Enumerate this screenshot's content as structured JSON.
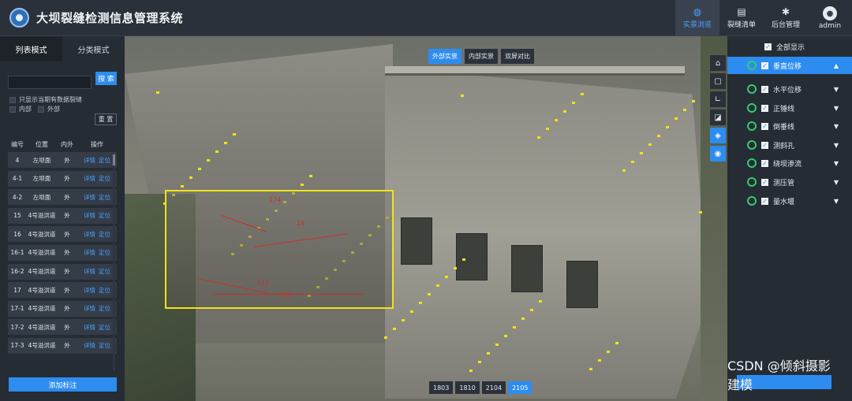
{
  "header": {
    "title": "大坝裂缝检测信息管理系统",
    "nav": [
      {
        "label": "实景浏览",
        "icon": "globe-icon",
        "active": true
      },
      {
        "label": "裂缝清单",
        "icon": "book-icon",
        "active": false
      },
      {
        "label": "后台管理",
        "icon": "gear-icon",
        "active": false
      },
      {
        "label": "admin",
        "icon": "user-icon",
        "active": false
      }
    ]
  },
  "left": {
    "tabs": [
      "列表模式",
      "分类模式"
    ],
    "search_placeholder": "",
    "search_label": "搜 索",
    "only_current": "只显示当期有数据裂缝",
    "inner": "内部",
    "outer": "外部",
    "reset_label": "重 置",
    "columns": [
      "编号",
      "位置",
      "内外",
      "操作"
    ],
    "rows": [
      {
        "id": "4",
        "pos": "左坝面",
        "io": "外"
      },
      {
        "id": "4-1",
        "pos": "左坝面",
        "io": "外"
      },
      {
        "id": "4-2",
        "pos": "左坝面",
        "io": "外"
      },
      {
        "id": "15",
        "pos": "4号溢洪道",
        "io": "外"
      },
      {
        "id": "16",
        "pos": "4号溢洪道",
        "io": "外"
      },
      {
        "id": "16-1",
        "pos": "4号溢洪道",
        "io": "外"
      },
      {
        "id": "16-2",
        "pos": "4号溢洪道",
        "io": "外"
      },
      {
        "id": "17",
        "pos": "4号溢洪道",
        "io": "外"
      },
      {
        "id": "17-1",
        "pos": "4号溢洪道",
        "io": "外"
      },
      {
        "id": "17-2",
        "pos": "4号溢洪道",
        "io": "外"
      },
      {
        "id": "17-3",
        "pos": "4号溢洪道",
        "io": "外"
      }
    ],
    "detail_label": "详情",
    "locate_label": "定位",
    "add_label": "添加标注"
  },
  "scene": {
    "view_tabs": [
      {
        "label": "外部实景",
        "active": true
      },
      {
        "label": "内部实景",
        "active": false
      },
      {
        "label": "双屏对比",
        "active": false
      }
    ],
    "tools": [
      "home-icon",
      "frame-icon",
      "angle-icon",
      "crop-icon",
      "layers-icon",
      "signal-icon"
    ],
    "time_tabs": [
      {
        "label": "1803",
        "active": false
      },
      {
        "label": "1810",
        "active": false
      },
      {
        "label": "2104",
        "active": false
      },
      {
        "label": "2105",
        "active": true
      }
    ],
    "crack_labels": [
      "174",
      "18",
      "112",
      "178"
    ]
  },
  "right": {
    "show_all": "全部显示",
    "layers": [
      {
        "label": "垂直位移",
        "active": true
      },
      {
        "label": "水平位移",
        "active": false
      },
      {
        "label": "正锤线",
        "active": false
      },
      {
        "label": "倒垂线",
        "active": false
      },
      {
        "label": "测斜孔",
        "active": false
      },
      {
        "label": "绕坝渗流",
        "active": false
      },
      {
        "label": "测压管",
        "active": false
      },
      {
        "label": "量水堰",
        "active": false
      }
    ]
  },
  "watermark": "CSDN @倾斜摄影建模"
}
